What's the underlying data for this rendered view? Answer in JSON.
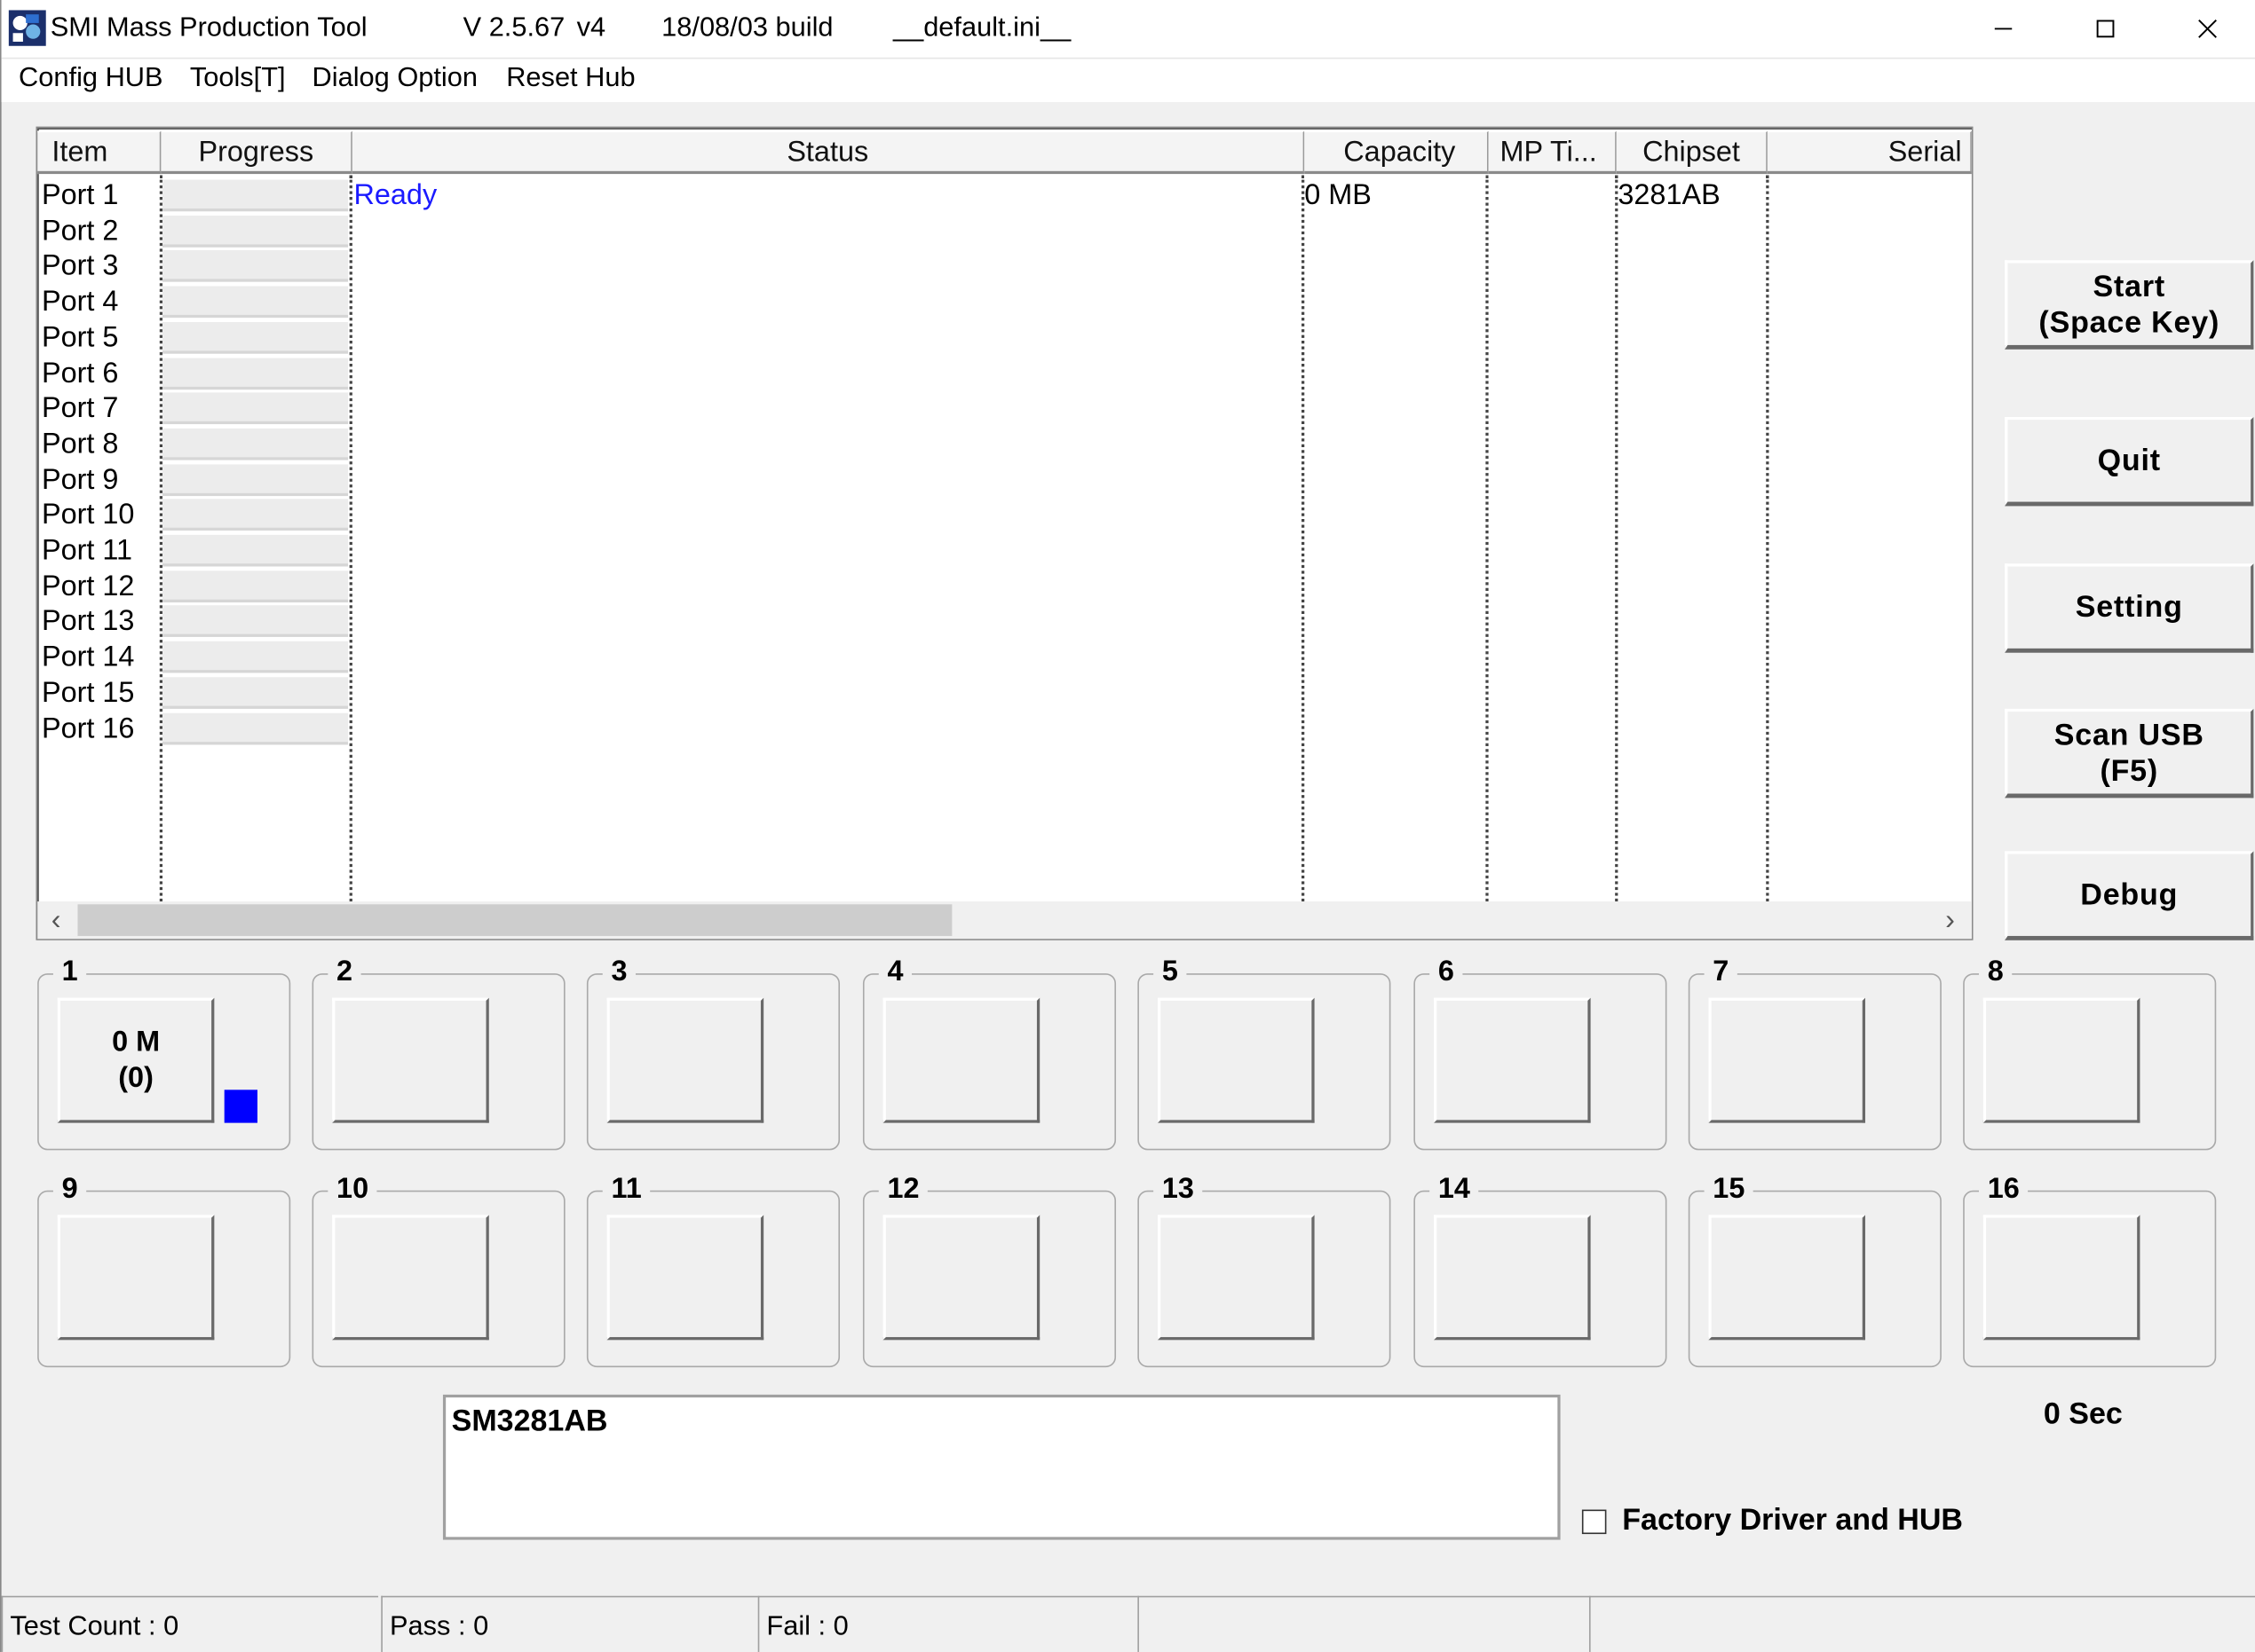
{
  "title_bar": {
    "app_title": "SMI Mass Production Tool",
    "version": "V 2.5.67",
    "variant": "v4",
    "build": "18/08/03 build",
    "ini_file": "__default.ini__"
  },
  "window_controls": {
    "minimize": "─",
    "maximize": "☐",
    "close": "✕"
  },
  "menu": [
    "Config HUB",
    "Tools[T]",
    "Dialog Option",
    "Reset Hub"
  ],
  "table": {
    "columns": [
      "Item",
      "Progress",
      "Status",
      "Capacity",
      "MP Ti...",
      "Chipset",
      "Serial"
    ],
    "ports": [
      "Port 1",
      "Port 2",
      "Port 3",
      "Port 4",
      "Port 5",
      "Port 6",
      "Port 7",
      "Port 8",
      "Port 9",
      "Port 10",
      "Port 11",
      "Port 12",
      "Port 13",
      "Port 14",
      "Port 15",
      "Port 16"
    ],
    "row1": {
      "status": "Ready",
      "capacity": "0 MB",
      "chipset": "3281AB"
    },
    "status_color": "#1a1aff"
  },
  "scrollbar": {
    "left_arrow": "‹",
    "right_arrow": "›"
  },
  "side_buttons": {
    "start_line1": "Start",
    "start_line2": "(Space Key)",
    "quit": "Quit",
    "setting": "Setting",
    "scan_line1": "Scan USB",
    "scan_line2": "(F5)",
    "debug": "Debug"
  },
  "port_groups": {
    "labels": [
      "1",
      "2",
      "3",
      "4",
      "5",
      "6",
      "7",
      "8",
      "9",
      "10",
      "11",
      "12",
      "13",
      "14",
      "15",
      "16"
    ],
    "port1_line1": "0 M",
    "port1_line2": "(0)",
    "indicator_color": "#0000ff"
  },
  "info_text": "SM3281AB",
  "timer": "0 Sec",
  "factory_checkbox": {
    "label": "Factory Driver and HUB",
    "checked": false
  },
  "status_bar": {
    "test_count": "Test Count : 0",
    "pass": "Pass : 0",
    "fail": "Fail : 0"
  }
}
